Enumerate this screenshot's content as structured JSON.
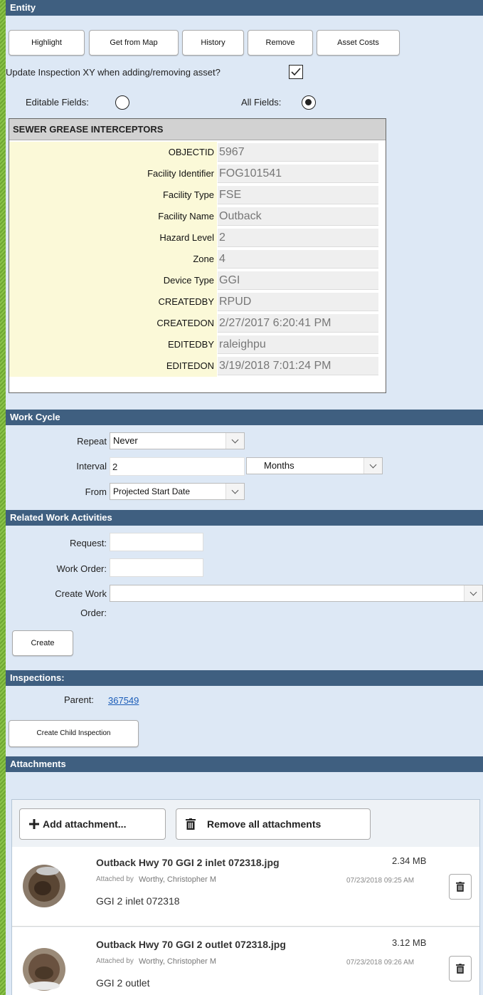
{
  "entity": {
    "header": "Entity",
    "buttons": [
      "Highlight",
      "Get from Map",
      "History",
      "Remove",
      "Asset Costs"
    ],
    "update_xy_label": "Update Inspection XY when adding/removing asset?",
    "editable_fields_label": "Editable Fields:",
    "all_fields_label": "All Fields:",
    "table_title": "SEWER GREASE INTERCEPTORS",
    "rows": [
      {
        "label": "OBJECTID",
        "value": "5967"
      },
      {
        "label": "Facility Identifier",
        "value": "FOG101541"
      },
      {
        "label": "Facility Type",
        "value": "FSE"
      },
      {
        "label": "Facility Name",
        "value": "Outback"
      },
      {
        "label": "Hazard Level",
        "value": "2"
      },
      {
        "label": "Zone",
        "value": "4"
      },
      {
        "label": "Device Type",
        "value": "GGI"
      },
      {
        "label": "CREATEDBY",
        "value": "RPUD"
      },
      {
        "label": "CREATEDON",
        "value": "2/27/2017 6:20:41 PM"
      },
      {
        "label": "EDITEDBY",
        "value": "raleighpu"
      },
      {
        "label": "EDITEDON",
        "value": "3/19/2018 7:01:24 PM"
      }
    ]
  },
  "work_cycle": {
    "header": "Work Cycle",
    "repeat_label": "Repeat",
    "repeat_value": "Never",
    "interval_label": "Interval",
    "interval_value": "2",
    "interval_unit": "Months",
    "from_label": "From",
    "from_value": "Projected Start Date"
  },
  "related": {
    "header": "Related Work Activities",
    "request_label": "Request:",
    "work_order_label": "Work Order:",
    "create_wo_label_1": "Create Work",
    "create_wo_label_2": "Order:",
    "create_button": "Create"
  },
  "inspections": {
    "header": "Inspections:",
    "parent_label": "Parent:",
    "parent_link": "367549",
    "create_child_button": "Create Child Inspection"
  },
  "attachments": {
    "header": "Attachments",
    "add_button": "Add attachment...",
    "remove_all_button": "Remove all attachments",
    "items": [
      {
        "filename": "Outback Hwy 70 GGI 2 inlet 072318.jpg",
        "size": "2.34 MB",
        "attached_by": "Attached by",
        "attached_by_name": "Worthy, Christopher M",
        "date": "07/23/2018 09:25 AM",
        "description": "GGI 2 inlet 072318"
      },
      {
        "filename": "Outback Hwy 70 GGI 2 outlet 072318.jpg",
        "size": "3.12 MB",
        "attached_by": "Attached by",
        "attached_by_name": "Worthy, Christopher M",
        "date": "07/23/2018 09:26 AM",
        "description": "GGI 2 outlet"
      }
    ]
  }
}
